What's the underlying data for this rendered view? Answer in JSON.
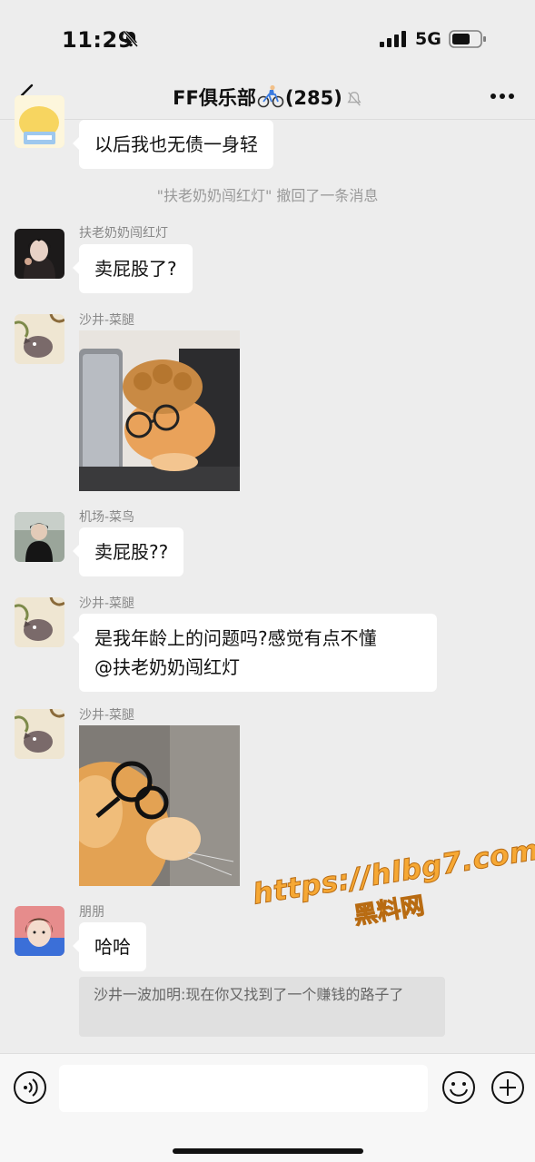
{
  "status_bar": {
    "time": "11:29",
    "network": "5G"
  },
  "header": {
    "title_prefix": "FF俱乐部",
    "title_count": "(285)"
  },
  "messages": [
    {
      "text": "以后我也无债一身轻"
    },
    {
      "system": "\"扶老奶奶闯红灯\" 撤回了一条消息"
    },
    {
      "sender": "扶老奶奶闯红灯",
      "text": "卖屁股了?"
    },
    {
      "sender": "沙井-菜腿",
      "sticker": "cat-glasses-sticker"
    },
    {
      "sender": "机场-菜鸟",
      "text": "卖屁股??"
    },
    {
      "sender": "沙井-菜腿",
      "text_line1": "是我年龄上的问题吗?感觉有点不懂",
      "text_line2": "@扶老奶奶闯红灯"
    },
    {
      "sender": "沙井-菜腿",
      "sticker": "cat-closeup-sticker"
    },
    {
      "sender": "朋朋",
      "text": "哈哈",
      "quote": "沙井一波加明:现在你又找到了一个赚钱的路子了"
    }
  ],
  "watermark": {
    "url": "https://hlbg7.com",
    "name": "黑料网"
  },
  "colors": {
    "background": "#ededed",
    "bubble": "#ffffff",
    "watermark": "#f6a834"
  }
}
